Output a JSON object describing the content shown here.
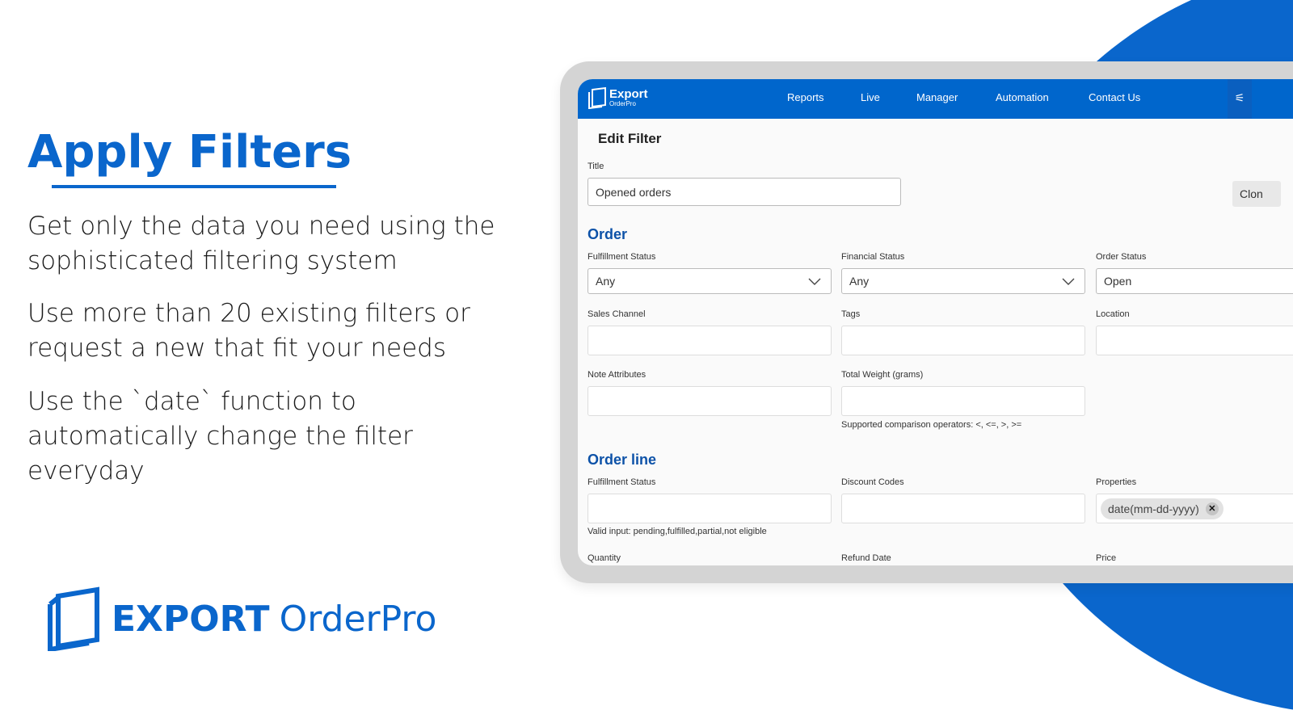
{
  "marketing": {
    "heading": "Apply Filters",
    "paragraphs": [
      "Get only the data you need using the sophisticated filtering system",
      "Use more than 20 existing filters or request a new that fit your needs",
      "Use the `date` function to automatically change the filter everyday"
    ],
    "brand_bold": "EXPORT",
    "brand_light": "OrderPro"
  },
  "colors": {
    "accent": "#0a66cc",
    "nav": "#0066cc",
    "section": "#0d52a8"
  },
  "app": {
    "logo_main": "Export",
    "logo_sub": "OrderPro",
    "nav": [
      "Reports",
      "Live",
      "Manager",
      "Automation",
      "Contact Us"
    ],
    "settings_icon": "sliders-icon",
    "page_title": "Edit Filter",
    "title_label": "Title",
    "title_value": "Opened orders",
    "clone_label": "Clon",
    "order": {
      "heading": "Order",
      "fulfillment_label": "Fulfillment Status",
      "fulfillment_value": "Any",
      "financial_label": "Financial Status",
      "financial_value": "Any",
      "order_status_label": "Order Status",
      "order_status_value": "Open",
      "sales_channel_label": "Sales Channel",
      "tags_label": "Tags",
      "location_label": "Location",
      "note_label": "Note Attributes",
      "weight_label": "Total Weight (grams)",
      "weight_hint": "Supported comparison operators: <, <=, >, >="
    },
    "order_line": {
      "heading": "Order line",
      "fulfillment_label": "Fulfillment Status",
      "fulfillment_hint": "Valid input: pending,fulfilled,partial,not eligible",
      "discount_label": "Discount Codes",
      "properties_label": "Properties",
      "properties_chip": "date(mm-dd-yyyy)",
      "quantity_label": "Quantity",
      "refund_label": "Refund Date",
      "price_label": "Price"
    }
  }
}
